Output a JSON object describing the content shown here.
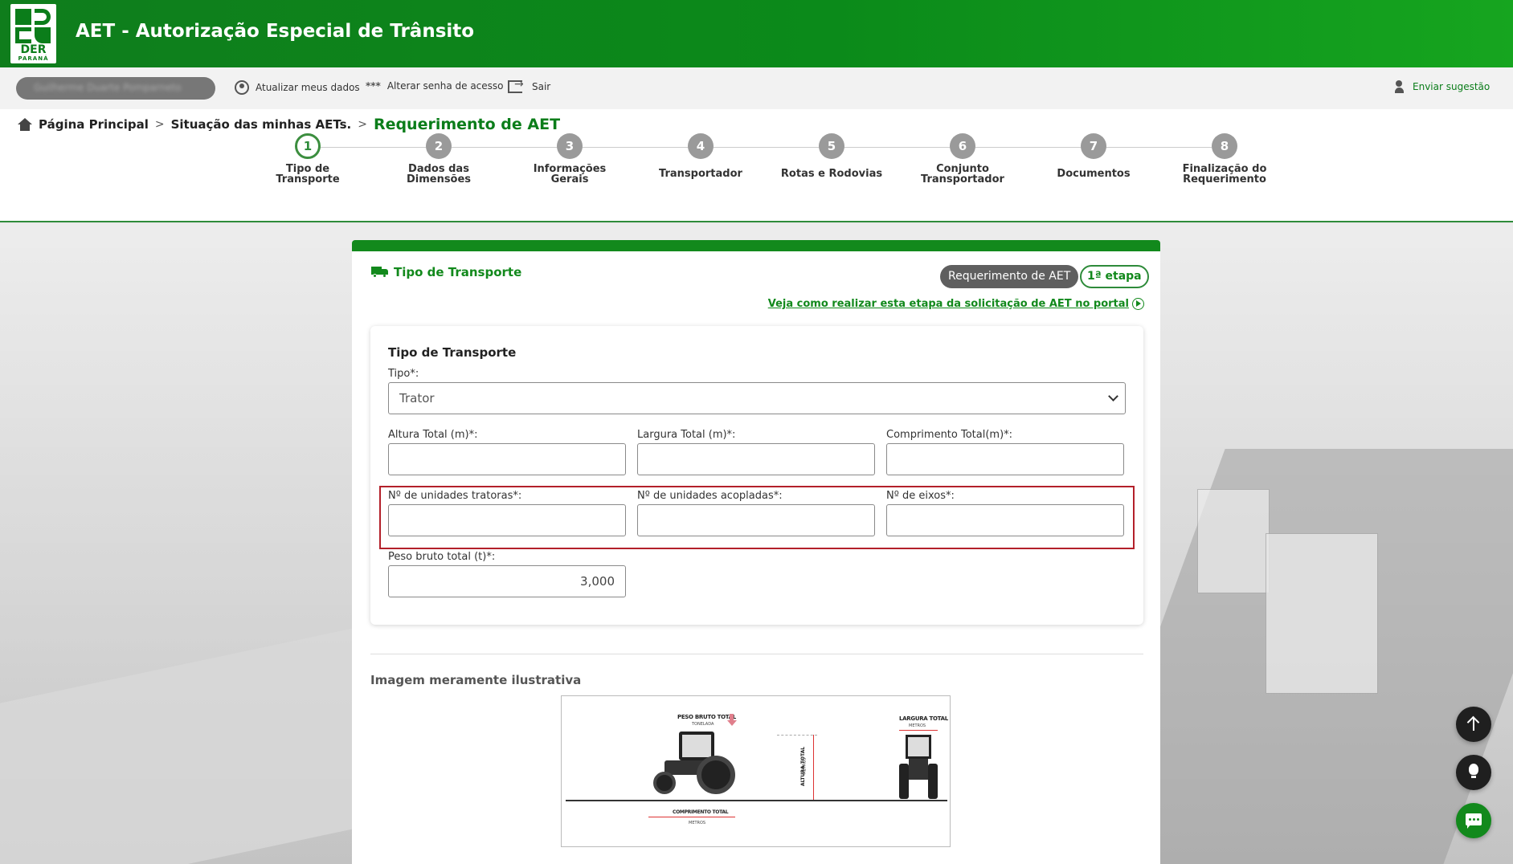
{
  "header": {
    "logo_text": "DER",
    "logo_subtext": "PARANÁ",
    "title": "AET - Autorização Especial de Trânsito"
  },
  "userbar": {
    "user_name": "Guilherme Duarte Pomparneto",
    "update_data": "Atualizar meus dados",
    "change_password": "Alterar senha de acesso",
    "logout": "Sair",
    "suggestion": "Enviar sugestão"
  },
  "breadcrumb": {
    "home": "Página Principal",
    "situation": "Situação das minhas AETs.",
    "current": "Requerimento de AET"
  },
  "steps": [
    {
      "num": "1",
      "label": "Tipo de Transporte"
    },
    {
      "num": "2",
      "label": "Dados das Dimensões"
    },
    {
      "num": "3",
      "label": "Informações Gerais"
    },
    {
      "num": "4",
      "label": "Transportador"
    },
    {
      "num": "5",
      "label": "Rotas e Rodovias"
    },
    {
      "num": "6",
      "label": "Conjunto Transportador"
    },
    {
      "num": "7",
      "label": "Documentos"
    },
    {
      "num": "8",
      "label": "Finalização do Requerimento"
    }
  ],
  "card": {
    "title": "Tipo de Transporte",
    "badge_request": "Requerimento de AET",
    "badge_step": "1ª etapa",
    "help_link": "Veja como realizar esta etapa da solicitação de AET no portal"
  },
  "form": {
    "heading": "Tipo de Transporte",
    "tipo_label": "Tipo*:",
    "tipo_value": "Trator",
    "altura_label": "Altura Total (m)*:",
    "altura_value": "",
    "largura_label": "Largura Total (m)*:",
    "largura_value": "",
    "comprimento_label": "Comprimento Total(m)*:",
    "comprimento_value": "",
    "tratoras_label": "Nº de unidades tratoras*:",
    "tratoras_value": "",
    "acopladas_label": "Nº de unidades acopladas*:",
    "acopladas_value": "",
    "eixos_label": "Nº de eixos*:",
    "eixos_value": "",
    "peso_label": "Peso bruto total (t)*:",
    "peso_value": "3,000"
  },
  "illustration": {
    "title": "Imagem meramente ilustrativa",
    "peso_label": "PESO BRUTO TOTAL",
    "peso_unit": "TONELADA",
    "altura_label": "ALTURA TOTAL",
    "altura_unit": "METROS",
    "largura_label": "LARGURA TOTAL",
    "largura_unit": "METROS",
    "comprimento_label": "COMPRIMENTO TOTAL",
    "comprimento_unit": "METROS"
  },
  "colors": {
    "brand_green": "#12891c",
    "highlight_red": "#b3202a"
  }
}
